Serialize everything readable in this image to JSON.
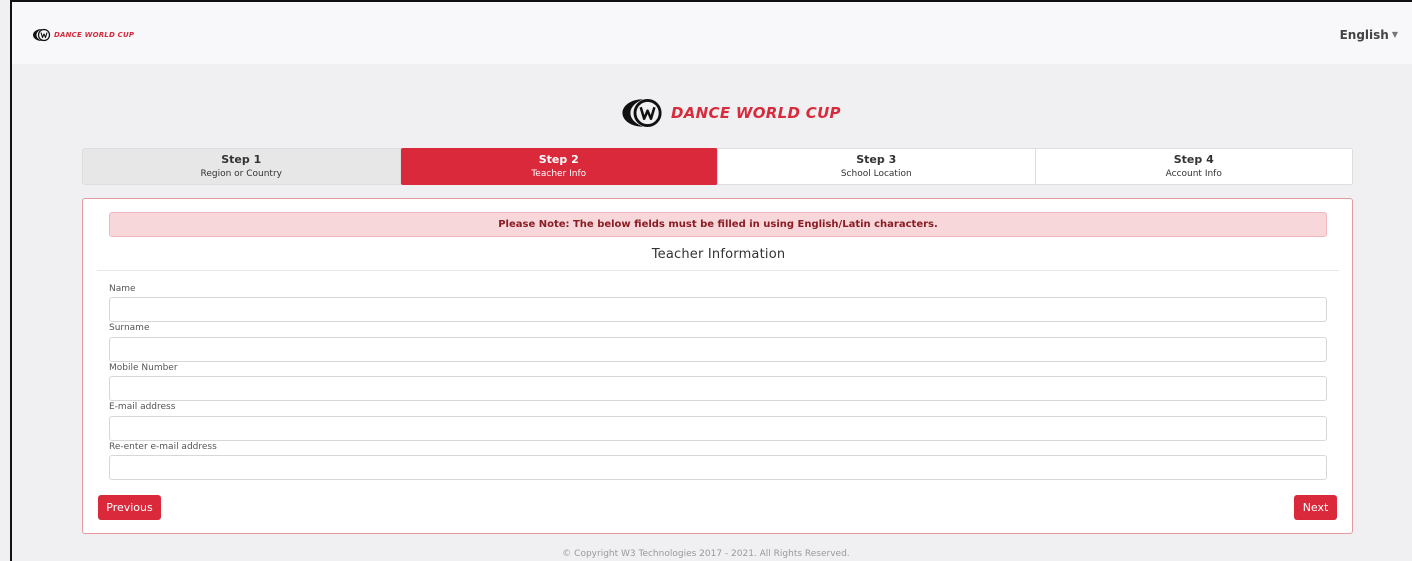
{
  "navbar": {
    "brand": "DANCE WORLD CUP",
    "language": "English"
  },
  "header": {
    "brand": "DANCE WORLD CUP"
  },
  "steps": [
    {
      "title": "Step 1",
      "subtitle": "Region or Country",
      "state": "done"
    },
    {
      "title": "Step 2",
      "subtitle": "Teacher Info",
      "state": "active"
    },
    {
      "title": "Step 3",
      "subtitle": "School Location",
      "state": "pending"
    },
    {
      "title": "Step 4",
      "subtitle": "Account Info",
      "state": "pending"
    }
  ],
  "form": {
    "note": "Please Note: The below fields must be filled in using English/Latin characters.",
    "title": "Teacher Information",
    "fields": {
      "name": {
        "label": "Name",
        "value": ""
      },
      "surname": {
        "label": "Surname",
        "value": ""
      },
      "mobile": {
        "label": "Mobile Number",
        "value": ""
      },
      "email": {
        "label": "E-mail address",
        "value": ""
      },
      "email_confirm": {
        "label": "Re-enter e-mail address",
        "value": ""
      }
    },
    "previous_label": "Previous",
    "next_label": "Next"
  },
  "footer": {
    "copyright": "© Copyright W3 Technologies 2017 - 2021. All Rights Reserved."
  },
  "colors": {
    "accent": "#d9293b",
    "note_bg": "#f7d7da",
    "note_text": "#8a1c24"
  }
}
